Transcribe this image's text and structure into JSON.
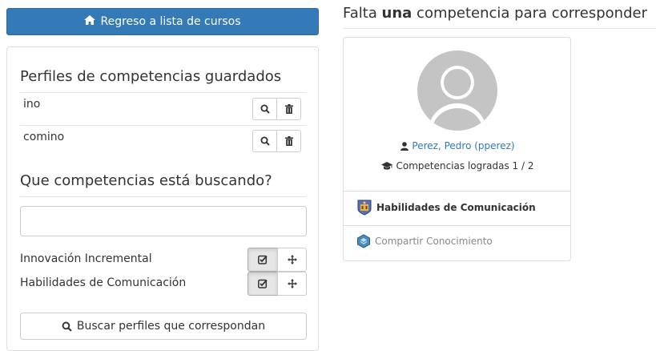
{
  "back_button": {
    "label": "Regreso a lista de cursos",
    "icon": "home-icon"
  },
  "saved_profiles": {
    "title": "Perfiles de competencias guardados",
    "items": [
      {
        "name": "ino"
      },
      {
        "name": "comino"
      }
    ]
  },
  "search_section": {
    "title": "Que competencias está buscando?",
    "input_value": "",
    "competencies": [
      {
        "name": "Innovación Incremental"
      },
      {
        "name": "Habilidades de Comunicación"
      }
    ],
    "search_button_label": "Buscar perfiles que correspondan"
  },
  "result": {
    "title_prefix": "Falta ",
    "title_emphasis": "una",
    "title_suffix": " competencia para corresponder",
    "user_link": "Perez, Pedro (pperez)",
    "competencies_label": "Competencias logradas 1 / 2",
    "missing_competency": "Habilidades de Comunicación",
    "achieved_competency": "Compartir Conocimiento"
  },
  "colors": {
    "primary": "#337ab7",
    "border": "#dddddd",
    "muted": "#888888"
  }
}
